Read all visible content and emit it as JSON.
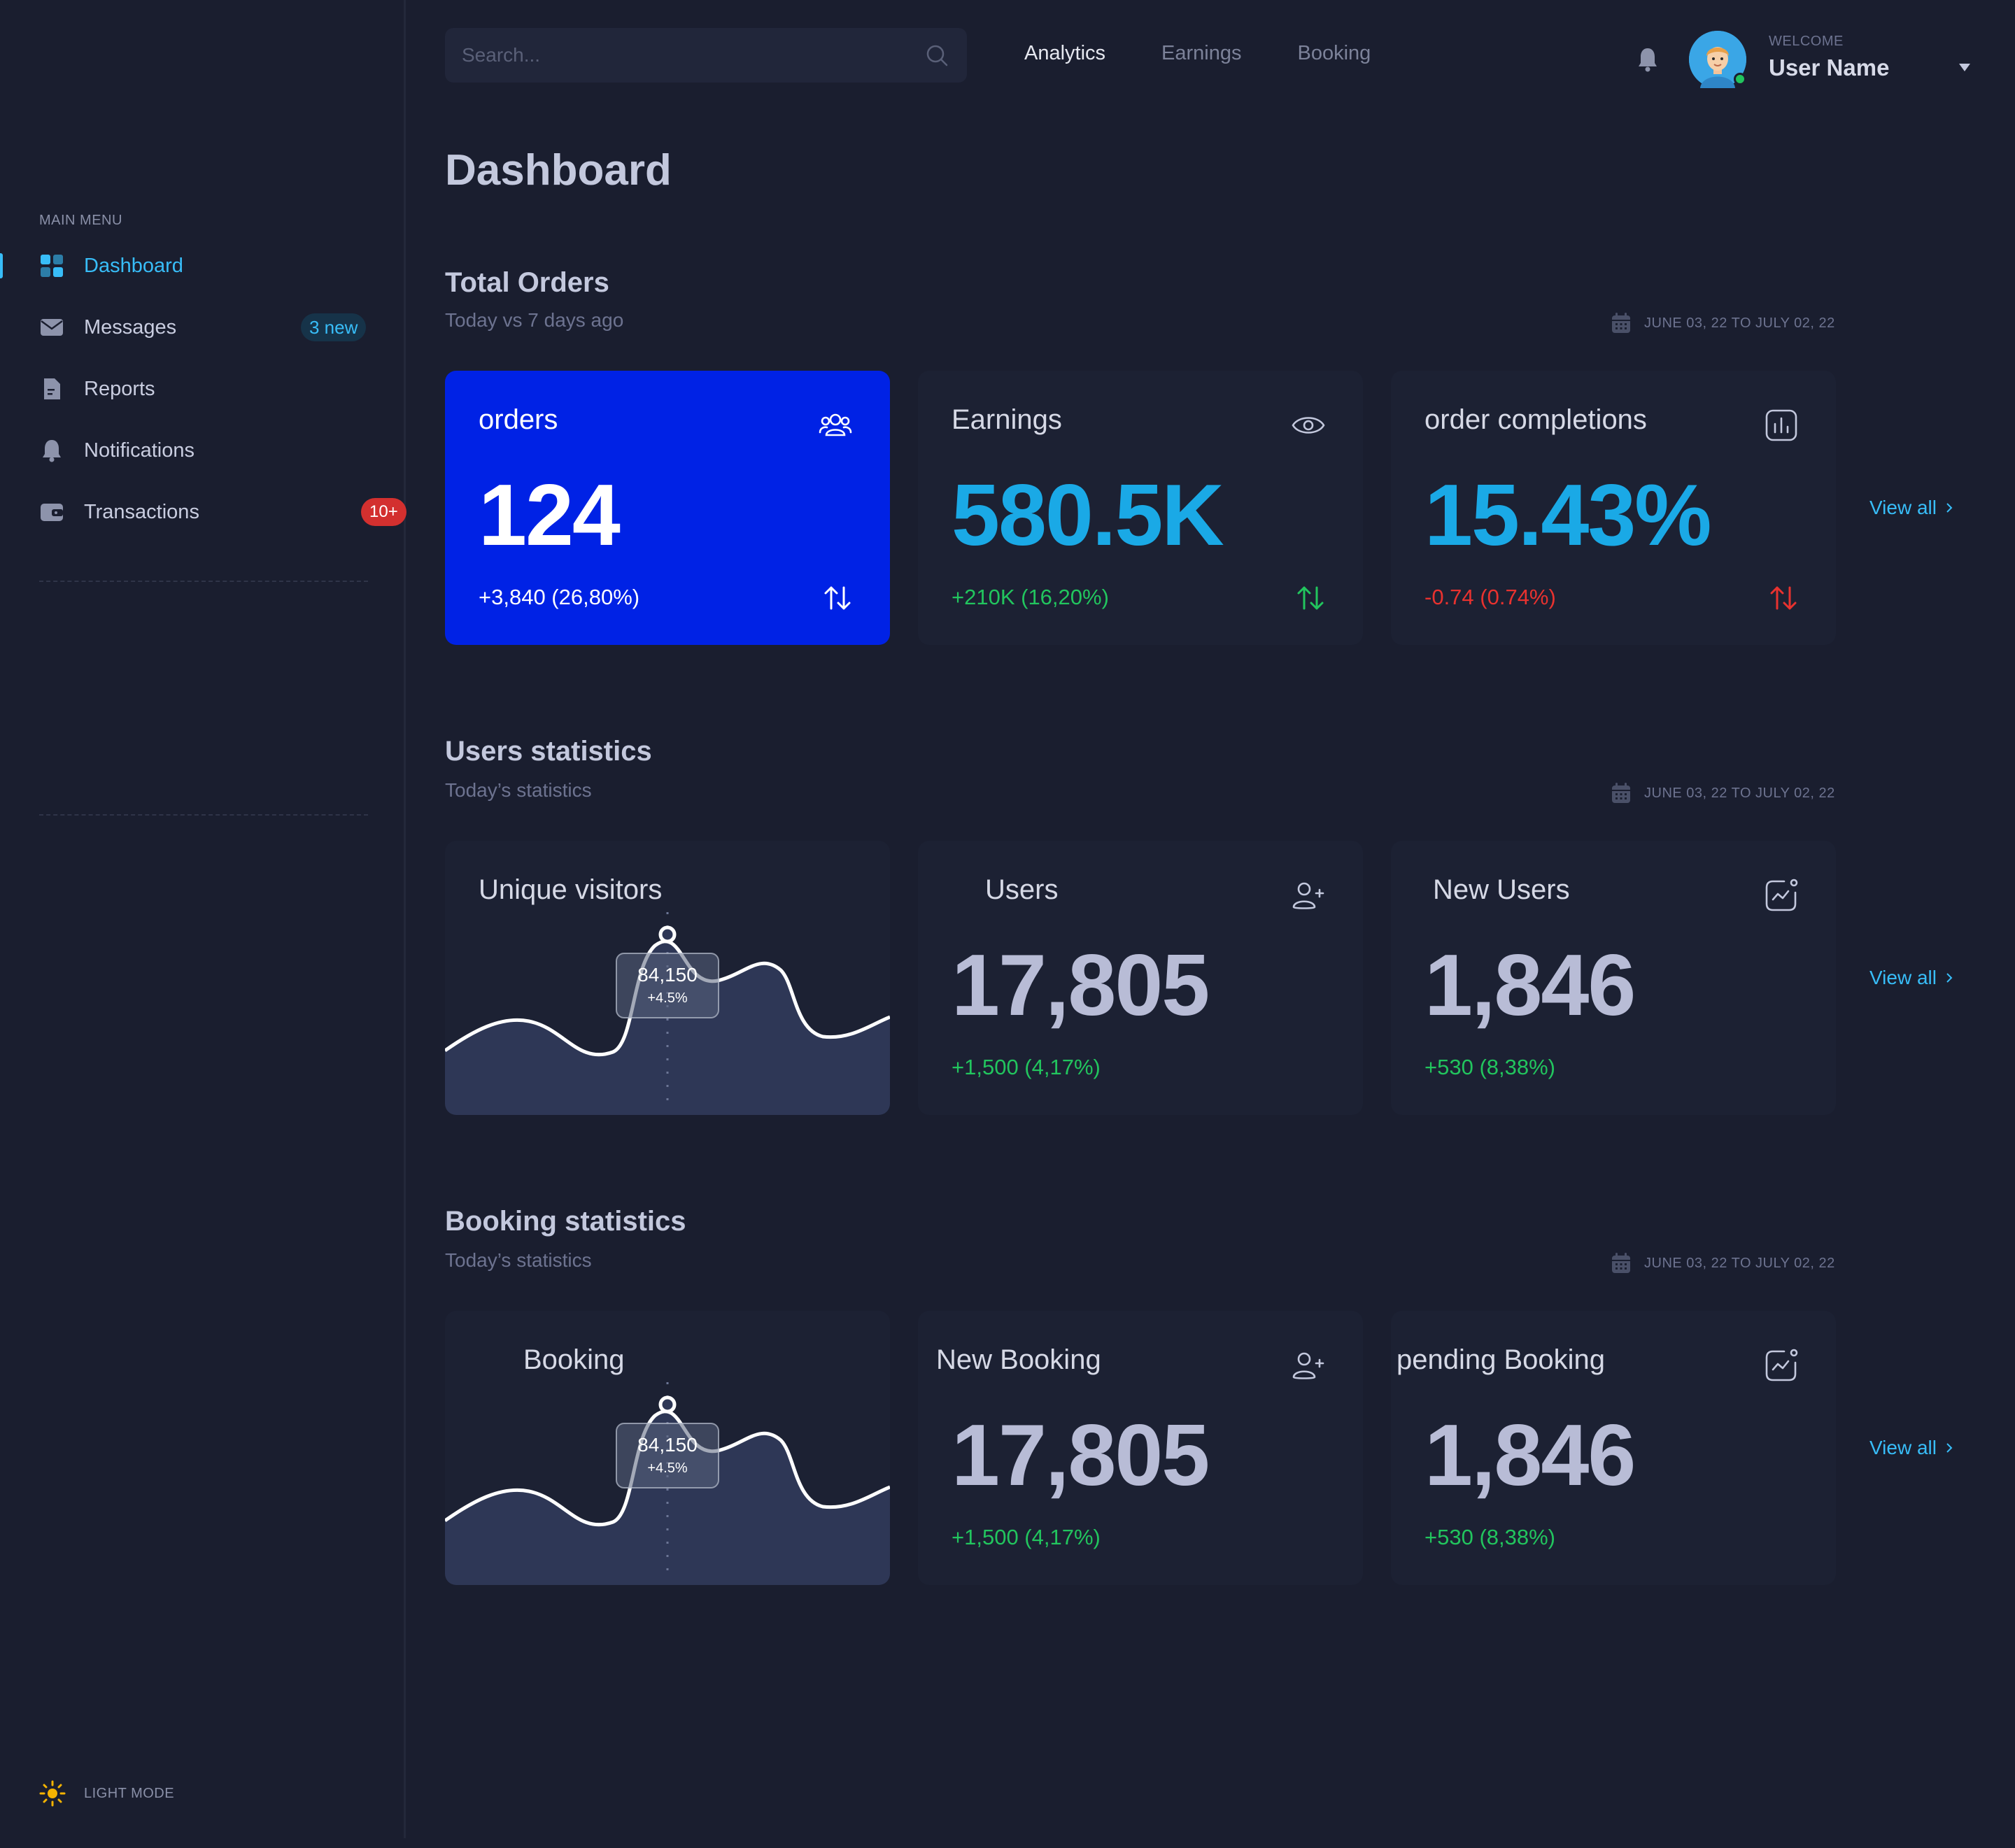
{
  "sidebar": {
    "menu_title": "MAIN MENU",
    "items": [
      {
        "label": "Dashboard",
        "icon": "grid-icon",
        "active": true
      },
      {
        "label": "Messages",
        "icon": "mail-icon",
        "badge": "3 new"
      },
      {
        "label": "Reports",
        "icon": "document-icon"
      },
      {
        "label": "Notifications",
        "icon": "bell-icon"
      },
      {
        "label": "Transactions",
        "icon": "wallet-icon",
        "badge": "10+"
      }
    ],
    "light_mode_label": "LIGHT MODE"
  },
  "topbar": {
    "search_placeholder": "Search...",
    "nav": [
      "Analytics",
      "Earnings",
      "Booking"
    ],
    "active_nav": "Analytics",
    "welcome": "WELCOME",
    "username": "User Name"
  },
  "page_title": "Dashboard",
  "colors": {
    "background": "#1a1e2f",
    "card": "#1c2133",
    "accent_blue": "#0022e5",
    "cyan": "#1aa9e6",
    "positive": "#22c55e",
    "negative": "#e8322f",
    "link": "#38bdf8"
  },
  "sections": {
    "total_orders": {
      "title": "Total Orders",
      "subtitle": "Today vs 7 days ago",
      "date_range": "JUNE 03, 22 TO JULY 02, 22",
      "view_all": "View all",
      "cards": [
        {
          "title": "orders",
          "value": "124",
          "delta": "+3,840 (26,80%)",
          "icon": "users-group-icon"
        },
        {
          "title": "Earnings",
          "value": "580.5K",
          "delta": "+210K (16,20%)",
          "icon": "eye-icon"
        },
        {
          "title": "order completions",
          "value": "15.43%",
          "delta": "-0.74 (0.74%)",
          "icon": "bar-chart-icon"
        }
      ]
    },
    "users_statistics": {
      "title": "Users statistics",
      "subtitle": "Today’s statistics",
      "date_range": "JUNE 03, 22 TO JULY 02, 22",
      "view_all": "View all",
      "chart": {
        "title": "Unique visitors",
        "tooltip_value": "84,150",
        "tooltip_delta": "+4.5%"
      },
      "cards": [
        {
          "title": "Users",
          "value": "17,805",
          "delta": "+1,500 (4,17%)",
          "icon": "user-add-icon"
        },
        {
          "title": "New Users",
          "value": "1,846",
          "delta": "+530 (8,38%)",
          "icon": "trend-notification-icon"
        }
      ]
    },
    "booking_statistics": {
      "title": "Booking statistics",
      "subtitle": "Today’s statistics",
      "date_range": "JUNE 03, 22 TO JULY 02, 22",
      "view_all": "View all",
      "chart": {
        "title": "Booking",
        "tooltip_value": "84,150",
        "tooltip_delta": "+4.5%"
      },
      "cards": [
        {
          "title": "New Booking",
          "value": "17,805",
          "delta": "+1,500 (4,17%)",
          "icon": "user-add-icon"
        },
        {
          "title": "pending Booking",
          "value": "1,846",
          "delta": "+530 (8,38%)",
          "icon": "trend-notification-icon"
        }
      ]
    }
  }
}
